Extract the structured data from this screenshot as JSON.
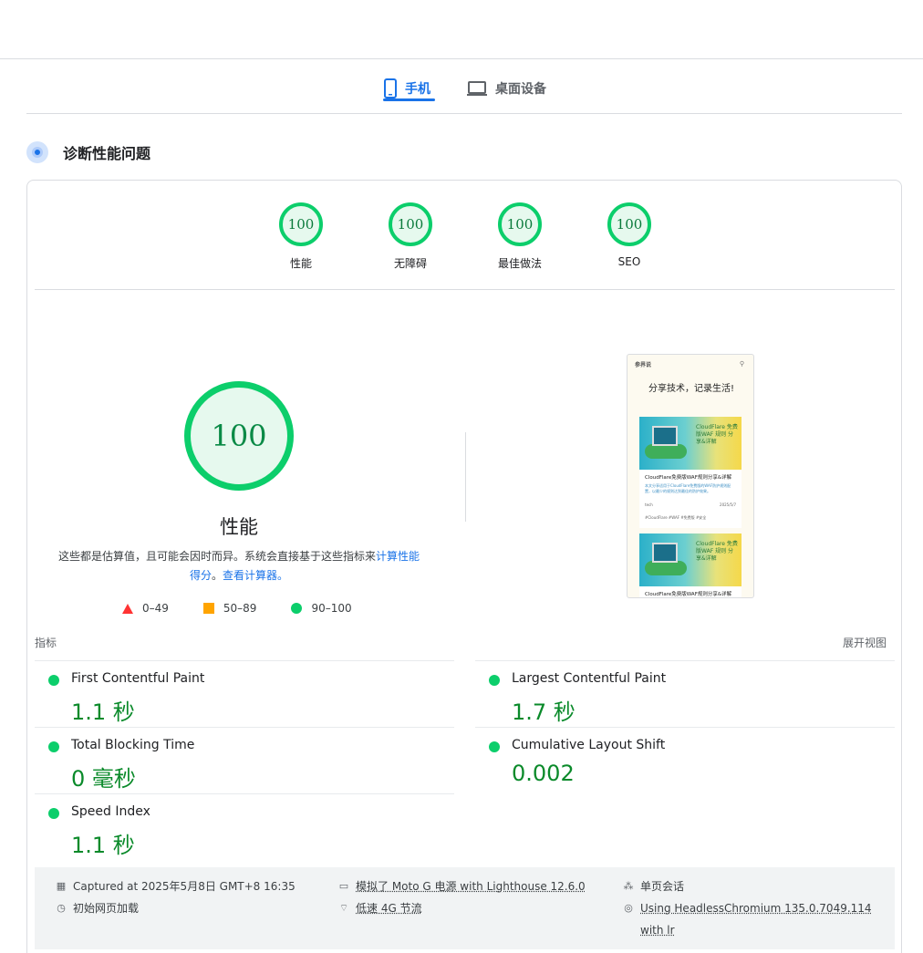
{
  "tabs": {
    "mobile_label": "手机",
    "desktop_label": "桌面设备"
  },
  "diagnose": {
    "title": "诊断性能问题"
  },
  "categories": [
    {
      "score": "100",
      "label": "性能"
    },
    {
      "score": "100",
      "label": "无障碍"
    },
    {
      "score": "100",
      "label": "最佳做法"
    },
    {
      "score": "100",
      "label": "SEO"
    }
  ],
  "performance": {
    "score": "100",
    "label": "性能",
    "description_prefix": "这些都是估算值，且可能会因时而异。系统会直接基于这些指标来",
    "calc_link": "计算性能得分",
    "description_mid": "。",
    "calculator_link": "查看计算器。"
  },
  "legend": [
    {
      "shape": "triangle",
      "range": "0–49",
      "color": "#ff3333"
    },
    {
      "shape": "square",
      "range": "50–89",
      "color": "#ffa400"
    },
    {
      "shape": "circle",
      "range": "90–100",
      "color": "#0cce6b"
    }
  ],
  "screenshot": {
    "site_name": "参界说",
    "slogan": "分享技术，记录生活!",
    "image_text": "CloudFlare 免费版WAF 规则 分享&详解",
    "post_title": "CloudFlare免费版WAF规则分享&详解",
    "post_excerpt": "本文分享适用于CloudFlare免费版的WAF防护规则配置，以最少的规则达到最佳的防护效果。",
    "post_category": "tech",
    "post_date": "2025/5/7",
    "post_tags": "#CloudFlare  #WAF  #免费版  #安全"
  },
  "metrics": {
    "header": "指标",
    "expand": "展开视图",
    "items": [
      {
        "name": "First Contentful Paint",
        "value": "1.1 秒",
        "status": "pass"
      },
      {
        "name": "Largest Contentful Paint",
        "value": "1.7 秒",
        "status": "pass"
      },
      {
        "name": "Total Blocking Time",
        "value": "0 毫秒",
        "status": "pass"
      },
      {
        "name": "Cumulative Layout Shift",
        "value": "0.002",
        "status": "pass"
      },
      {
        "name": "Speed Index",
        "value": "1.1 秒",
        "status": "pass"
      }
    ]
  },
  "footer": {
    "captured": "Captured at 2025年5月8日 GMT+8 16:35",
    "load_type": "初始网页加载",
    "emulation": "模拟了 Moto G 电源 with Lighthouse 12.6.0",
    "throttling": "低速 4G 节流",
    "session": "单页会话",
    "browser": "Using HeadlessChromium 135.0.7049.114 with lr"
  },
  "colors": {
    "accent": "#1a73e8",
    "pass": "#0cce6b",
    "average": "#ffa400",
    "fail": "#ff3333",
    "pass_text": "#0a8a2a"
  }
}
